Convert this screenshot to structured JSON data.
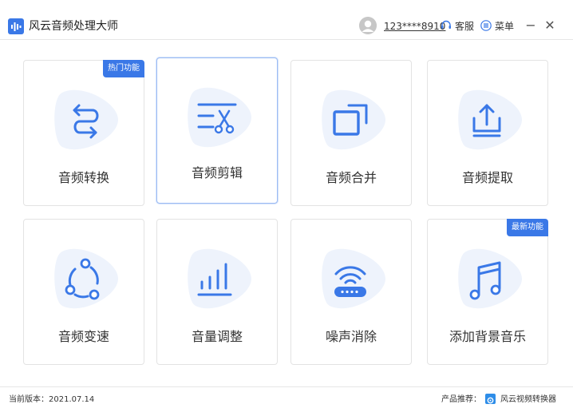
{
  "app": {
    "title": "风云音频处理大师"
  },
  "header": {
    "user_name": "123****8910",
    "service_label": "客服",
    "menu_label": "菜单",
    "minimize_glyph": "−",
    "close_glyph": "✕"
  },
  "colors": {
    "accent": "#3a78e7",
    "blob": "#eef3fc",
    "border": "#e3e3e3"
  },
  "cards": [
    {
      "label": "音频转换",
      "icon": "convert-arrows-icon",
      "badge": "热门功能"
    },
    {
      "label": "音频剪辑",
      "icon": "scissors-cut-icon",
      "badge": ""
    },
    {
      "label": "音频合并",
      "icon": "merge-squares-icon",
      "badge": ""
    },
    {
      "label": "音频提取",
      "icon": "upload-extract-icon",
      "badge": ""
    },
    {
      "label": "音频变速",
      "icon": "speed-nodes-icon",
      "badge": ""
    },
    {
      "label": "音量调整",
      "icon": "volume-bars-icon",
      "badge": ""
    },
    {
      "label": "噪声消除",
      "icon": "noise-router-icon",
      "badge": ""
    },
    {
      "label": "添加背景音乐",
      "icon": "music-note-icon",
      "badge": "最新功能"
    }
  ],
  "footer": {
    "version_label": "当前版本：2021.07.14",
    "recommend_label": "产品推荐：",
    "recommend_name": "风云视频转换器"
  }
}
